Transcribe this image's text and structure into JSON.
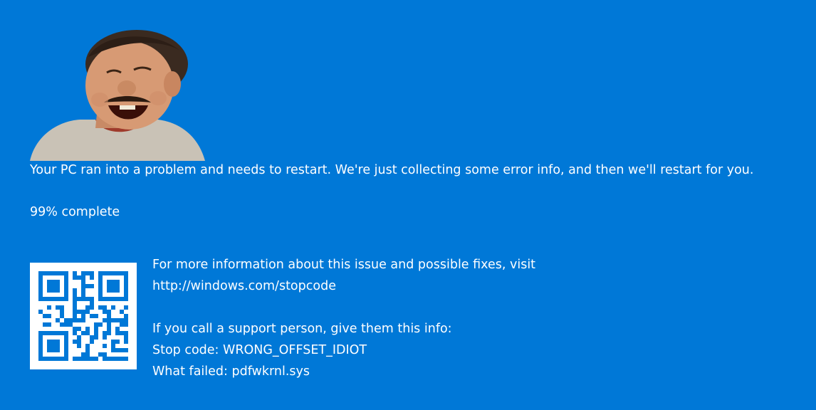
{
  "screen": {
    "background_color": "#0078d7",
    "text_color": "#ffffff"
  },
  "face_image": {
    "icon": "laughing-man-face-image"
  },
  "message": "Your PC ran into a problem and needs to restart. We're just collecting some error info, and then we'll restart for you.",
  "progress": {
    "percent": 99,
    "text": "99% complete"
  },
  "qr": {
    "icon": "qr-code-icon"
  },
  "info": {
    "more_info_text": "For more information about this issue and possible fixes, visit",
    "url": "http://windows.com/stopcode",
    "support_intro": "If you call a support person, give them this info:",
    "stop_code": "Stop code: WRONG_OFFSET_IDIOT",
    "what_failed": "What failed: pdfwkrnl.sys"
  }
}
